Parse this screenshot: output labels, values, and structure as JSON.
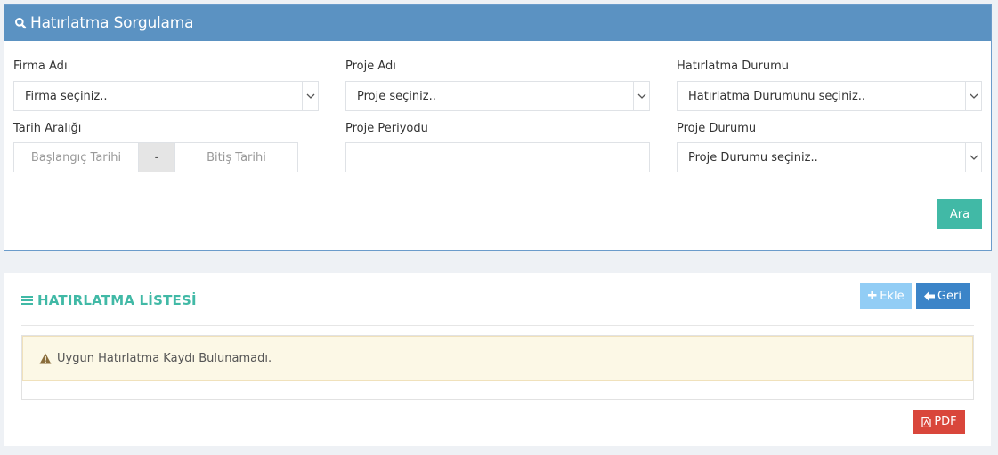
{
  "search": {
    "title": "Hatırlatma Sorgulama",
    "firma_label": "Firma Adı",
    "firma_value": "Firma seçiniz..",
    "proje_label": "Proje Adı",
    "proje_value": "Proje seçiniz..",
    "durum_label": "Hatırlatma Durumu",
    "durum_value": "Hatırlatma Durumunu seçiniz..",
    "tarih_label": "Tarih Aralığı",
    "tarih_start_placeholder": "Başlangıç Tarihi",
    "tarih_separator": "-",
    "tarih_end_placeholder": "Bitiş Tarihi",
    "periyot_label": "Proje Periyodu",
    "periyot_value": "",
    "proje_durum_label": "Proje Durumu",
    "proje_durum_value": "Proje Durumu seçiniz..",
    "search_button": "Ara"
  },
  "list": {
    "title": "HATIRLATMA LİSTESİ",
    "add_button": "Ekle",
    "back_button": "Geri",
    "empty_message": "Uygun Hatırlatma Kaydı Bulunamadı.",
    "pdf_button": "PDF"
  },
  "colors": {
    "header_blue": "#5b92c2",
    "teal": "#41b9a6",
    "add_blue": "#92cdf5",
    "back_blue": "#3b84c8",
    "pdf_red": "#d9463b",
    "warning_bg": "#fcf8e6"
  },
  "icons": {
    "search": "search-icon",
    "list": "list-icon",
    "plus": "plus-icon",
    "back": "arrow-left-icon",
    "warning": "warning-icon",
    "pdf": "file-pdf-icon",
    "dropdown": "chevron-down-icon"
  }
}
